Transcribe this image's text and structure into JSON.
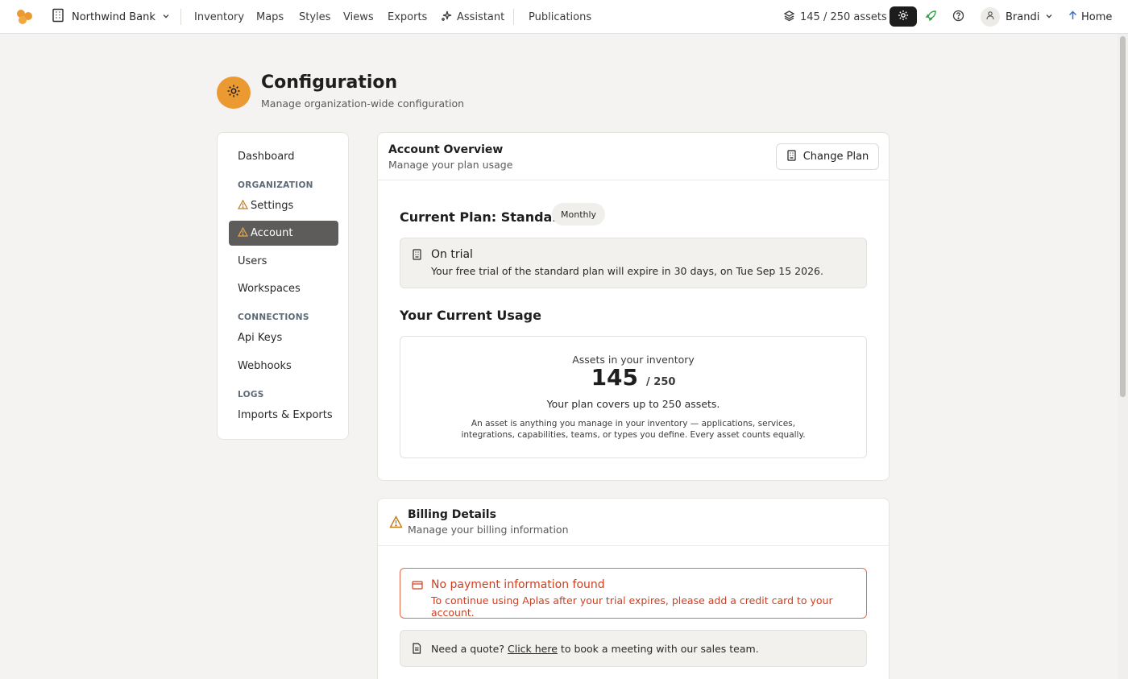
{
  "topbar": {
    "org_name": "Northwind Bank",
    "nav": [
      "Inventory",
      "Maps",
      "Styles",
      "Views",
      "Exports",
      "Assistant",
      "Publications"
    ],
    "usage_text": "145 / 250 assets",
    "user_name": "Brandi",
    "home_label": "Home"
  },
  "header": {
    "title": "Configuration",
    "subtitle": "Manage organization-wide configuration"
  },
  "sidebar": {
    "dashboard": "Dashboard",
    "organization_heading": "ORGANIZATION",
    "settings": "Settings",
    "account": "Account",
    "users": "Users",
    "workspaces": "Workspaces",
    "connections_heading": "CONNECTIONS",
    "api_keys": "Api Keys",
    "webhooks": "Webhooks",
    "logs_heading": "LOGS",
    "imports_exports": "Imports & Exports"
  },
  "account_overview": {
    "title": "Account Overview",
    "subtitle": "Manage your plan usage",
    "change_plan_label": "Change Plan",
    "current_plan": "Current Plan: Standard",
    "billing_cycle": "Monthly",
    "trial_title": "On trial",
    "trial_text": "Your free trial of the standard plan will expire in 30 days, on Tue Sep 15 2026.",
    "usage_heading": "Your Current Usage",
    "usage_label": "Assets in your inventory",
    "usage_count": "145",
    "usage_limit": "/ 250",
    "usage_covers": "Your plan covers up to 250 assets.",
    "usage_description": "An asset is anything you manage in your inventory — applications, services, integrations, capabilities, teams, or types you define. Every asset counts equally."
  },
  "billing": {
    "title": "Billing Details",
    "subtitle": "Manage your billing information",
    "error_title": "No payment information found",
    "error_text": "To continue using Aplas after your trial expires, please add a credit card to your account.",
    "quote_prefix": "Need a quote?",
    "quote_link": "Click here",
    "quote_suffix": "to book a meeting with our sales team."
  },
  "colors": {
    "brand": "#eb9a32",
    "active_nav": "#5d5c5a",
    "error": "#cf3f1f",
    "warning": "#c07a1a",
    "rocket": "#2f9e44",
    "home_arrow": "#3b6fd6"
  },
  "icons": {
    "logo": "brand-logo-icon",
    "org": "building-icon",
    "assistant": "sparkle-icon",
    "usage": "layers-icon",
    "settings": "gear-icon",
    "launch": "rocket-icon",
    "help": "help-circle-icon",
    "user": "user-icon",
    "home": "arrow-up-icon",
    "warning": "warning-triangle-icon",
    "card": "credit-card-icon",
    "document": "document-icon"
  }
}
